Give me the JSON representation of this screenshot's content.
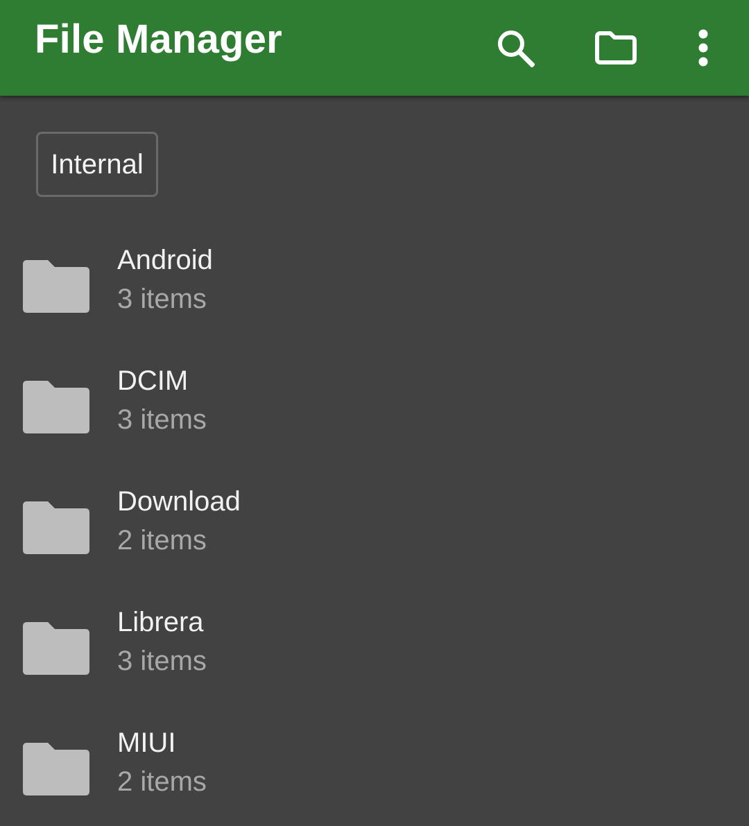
{
  "app_bar": {
    "title": "File Manager",
    "actions": [
      {
        "icon": "search-icon"
      },
      {
        "icon": "folder-icon"
      },
      {
        "icon": "more-vert-icon"
      }
    ],
    "color": "#2e7d32"
  },
  "storage": {
    "label": "Internal"
  },
  "files": [
    {
      "name": "Android",
      "count": "3 items"
    },
    {
      "name": "DCIM",
      "count": "3 items"
    },
    {
      "name": "Download",
      "count": "2 items"
    },
    {
      "name": "Librera",
      "count": "3 items"
    },
    {
      "name": "MIUI",
      "count": "2 items"
    }
  ],
  "colors": {
    "background": "#424242",
    "folder_icon": "#bdbdbd"
  }
}
